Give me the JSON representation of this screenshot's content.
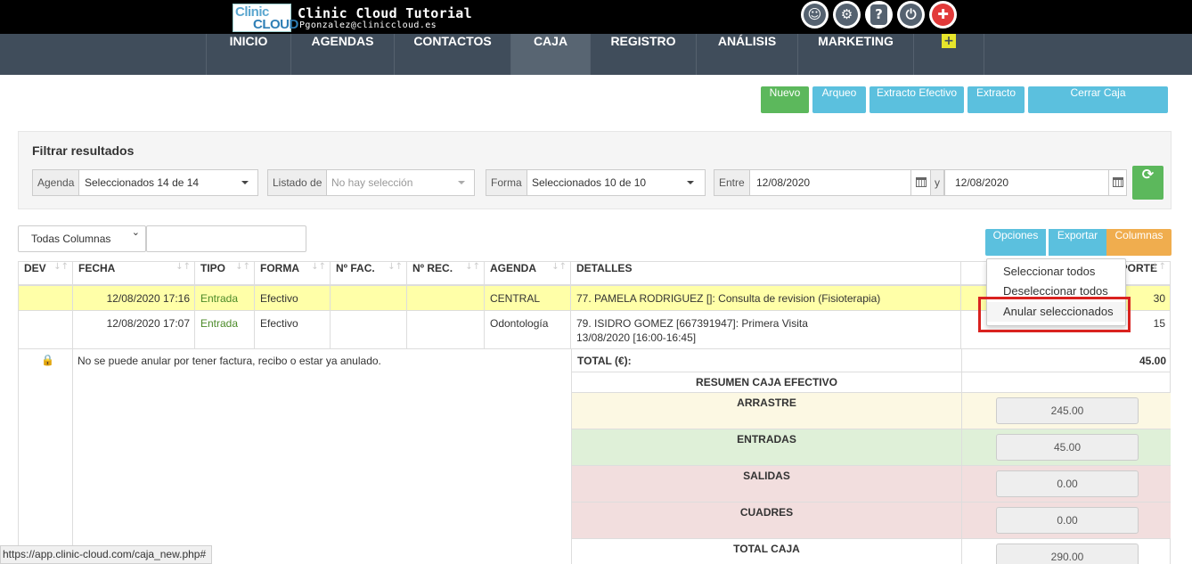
{
  "header": {
    "logo_line1": "Clinic",
    "logo_line2": "CLOUD",
    "title": "Clinic Cloud Tutorial",
    "user_email": "Pgonzalez@cliniccloud.es",
    "icons": [
      "face-icon",
      "gear-icon",
      "help-icon",
      "power-icon",
      "alert-icon"
    ]
  },
  "nav": {
    "items": [
      {
        "label": "INICIO"
      },
      {
        "label": "AGENDAS"
      },
      {
        "label": "CONTACTOS"
      },
      {
        "label": "CAJA",
        "active": true
      },
      {
        "label": "REGISTRO"
      },
      {
        "label": "ANÁLISIS"
      },
      {
        "label": "MARKETING"
      },
      {
        "label": "+"
      }
    ]
  },
  "actions": {
    "nuevo": "Nuevo",
    "arqueo": "Arqueo",
    "extracto_efectivo": "Extracto Efectivo",
    "extracto": "Extracto",
    "cerrar_caja": "Cerrar Caja"
  },
  "filter": {
    "title": "Filtrar resultados",
    "agenda_label": "Agenda",
    "agenda_value": "Seleccionados 14 de 14",
    "listado_label": "Listado de",
    "listado_placeholder": "No hay selección",
    "forma_label": "Forma",
    "forma_value": "Seleccionados 10 de 10",
    "entre_label": "Entre",
    "date_from": "12/08/2020",
    "y_label": "y",
    "date_to": "12/08/2020"
  },
  "table_tools": {
    "columns_select": "Todas Columnas",
    "opciones": "Opciones",
    "exportar": "Exportar",
    "columnas": "Columnas"
  },
  "table": {
    "headers": [
      "DEV",
      "FECHA",
      "TIPO",
      "FORMA",
      "Nº FAC.",
      "Nº REC.",
      "AGENDA",
      "DETALLES",
      "PORTE"
    ],
    "rows": [
      {
        "fecha": "12/08/2020 17:16",
        "tipo": "Entrada",
        "forma": "Efectivo",
        "agenda": "CENTRAL",
        "detalles_1": "77. PAMELA RODRIGUEZ []: Consulta de revision (Fisioterapia)",
        "detalles_2": "",
        "importe": "30"
      },
      {
        "fecha": "12/08/2020 17:07",
        "tipo": "Entrada",
        "forma": "Efectivo",
        "agenda": "Odontología",
        "detalles_1": "79. ISIDRO GOMEZ [667391947]: Primera Visita",
        "detalles_2": "13/08/2020 [16:00-16:45]",
        "importe": "15"
      }
    ],
    "lock_note": "No se puede anular por tener factura, recibo o estar ya anulado.",
    "total_label": "TOTAL (€):",
    "total_value": "45.00"
  },
  "summary": {
    "title": "RESUMEN CAJA EFECTIVO",
    "arrastre_label": "ARRASTRE",
    "arrastre_value": "245.00",
    "entradas_label": "ENTRADAS",
    "entradas_value": "45.00",
    "salidas_label": "SALIDAS",
    "salidas_value": "0.00",
    "cuadres_label": "CUADRES",
    "cuadres_value": "0.00",
    "total_caja_label": "TOTAL CAJA",
    "total_caja_value": "290.00",
    "colors": {
      "arrastre": "#fcf8e3",
      "entradas": "#dff0d8",
      "salidas": "#f2dede"
    }
  },
  "dropdown": {
    "items": [
      "Seleccionar todos",
      "Deseleccionar todos",
      "Anular seleccionados"
    ]
  },
  "statusbar": {
    "url": "https://app.clinic-cloud.com/caja_new.php#"
  }
}
